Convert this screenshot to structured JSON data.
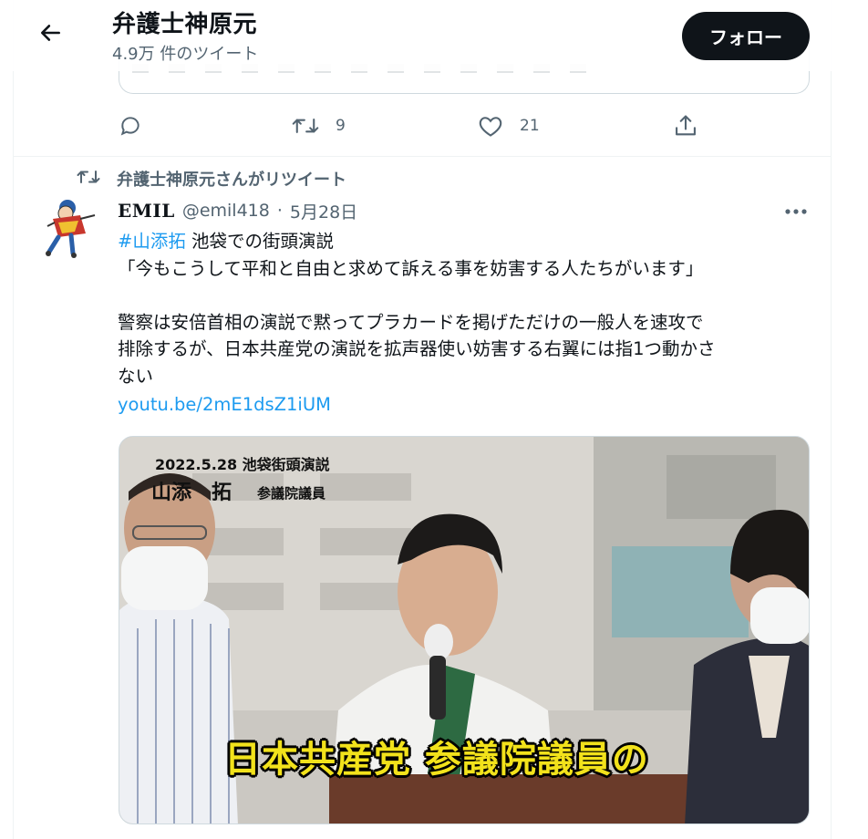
{
  "header": {
    "title": "弁護士神原元",
    "tweet_count": "4.9万 件のツイート",
    "follow_label": "フォロー"
  },
  "prev_tweet": {
    "retweets": "9",
    "likes": "21"
  },
  "retweet_context": {
    "label": "弁護士神原元さんがリツイート"
  },
  "tweet": {
    "display_name": "EMIL",
    "handle": "@emil418",
    "separator": "·",
    "date": "5月28日",
    "hashtag": "#山添拓",
    "line1_rest": " 池袋での街頭演説",
    "line2": "「今もこうして平和と自由と求めて訴える事を妨害する人たちがいます」",
    "line3": "警察は安倍首相の演説で黙ってプラカードを掲げただけの一般人を速攻で",
    "line4": "排除するが、日本共産党の演説を拡声器使い妨害する右翼には指1つ動かさ",
    "line5": "ない",
    "link": "youtu.be/2mE1dsZ1iUM"
  },
  "media": {
    "caption_date": "2022.5.28 池袋街頭演説",
    "caption_name": "山添　拓",
    "caption_role": "参議院議員",
    "subtitle": "日本共産党 参議院議員の"
  },
  "icons": [
    "back-arrow-icon",
    "reply-icon",
    "retweet-icon",
    "like-icon",
    "share-icon",
    "more-icon"
  ],
  "colors": {
    "accent": "#1d9bf0",
    "text": "#0f1419",
    "secondary": "#536471",
    "follow_bg": "#0f1419",
    "subtitle": "#f2e21b"
  }
}
